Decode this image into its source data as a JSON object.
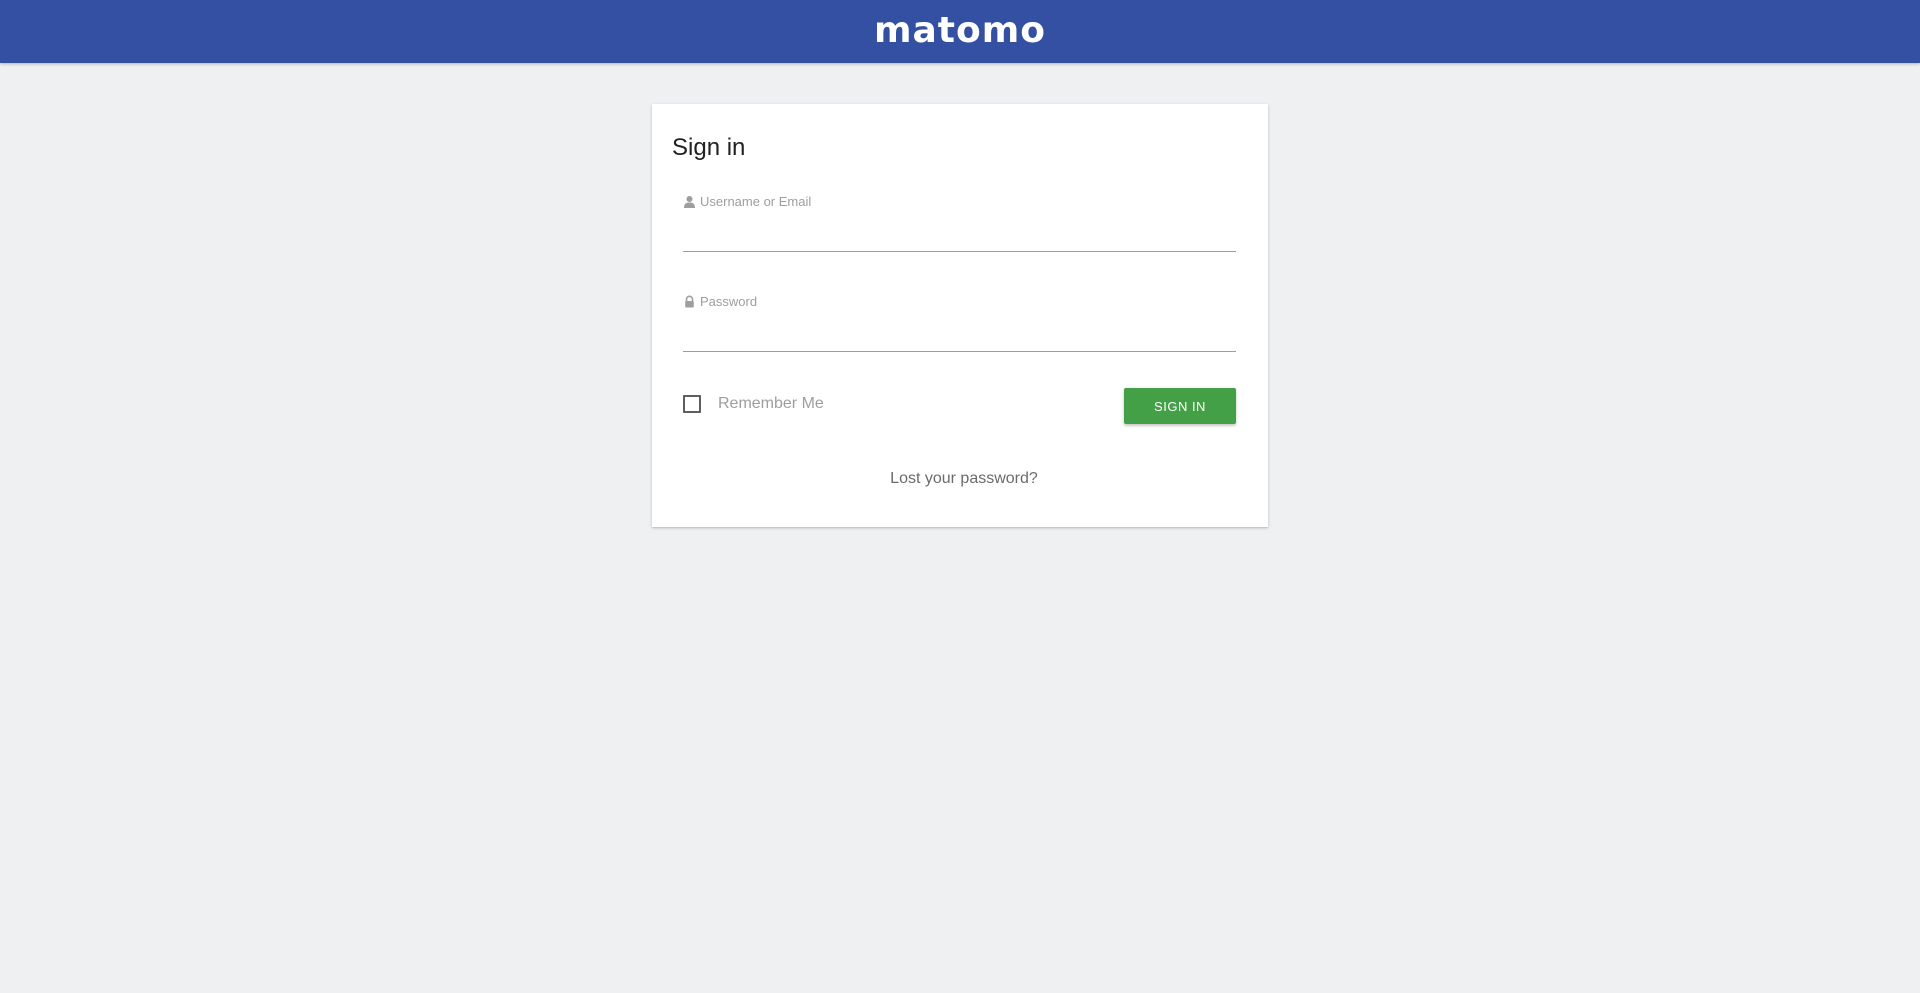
{
  "header": {
    "logo_text": "matomo",
    "background_color": "#3450a3"
  },
  "login": {
    "title": "Sign in",
    "username": {
      "label": "Username or Email",
      "value": "",
      "icon": "user-icon"
    },
    "password": {
      "label": "Password",
      "value": "",
      "icon": "lock-icon"
    },
    "remember_me": {
      "label": "Remember Me",
      "checked": false
    },
    "submit_label": "Sign in",
    "submit_color": "#43a047",
    "lost_password_label": "Lost your password?"
  }
}
